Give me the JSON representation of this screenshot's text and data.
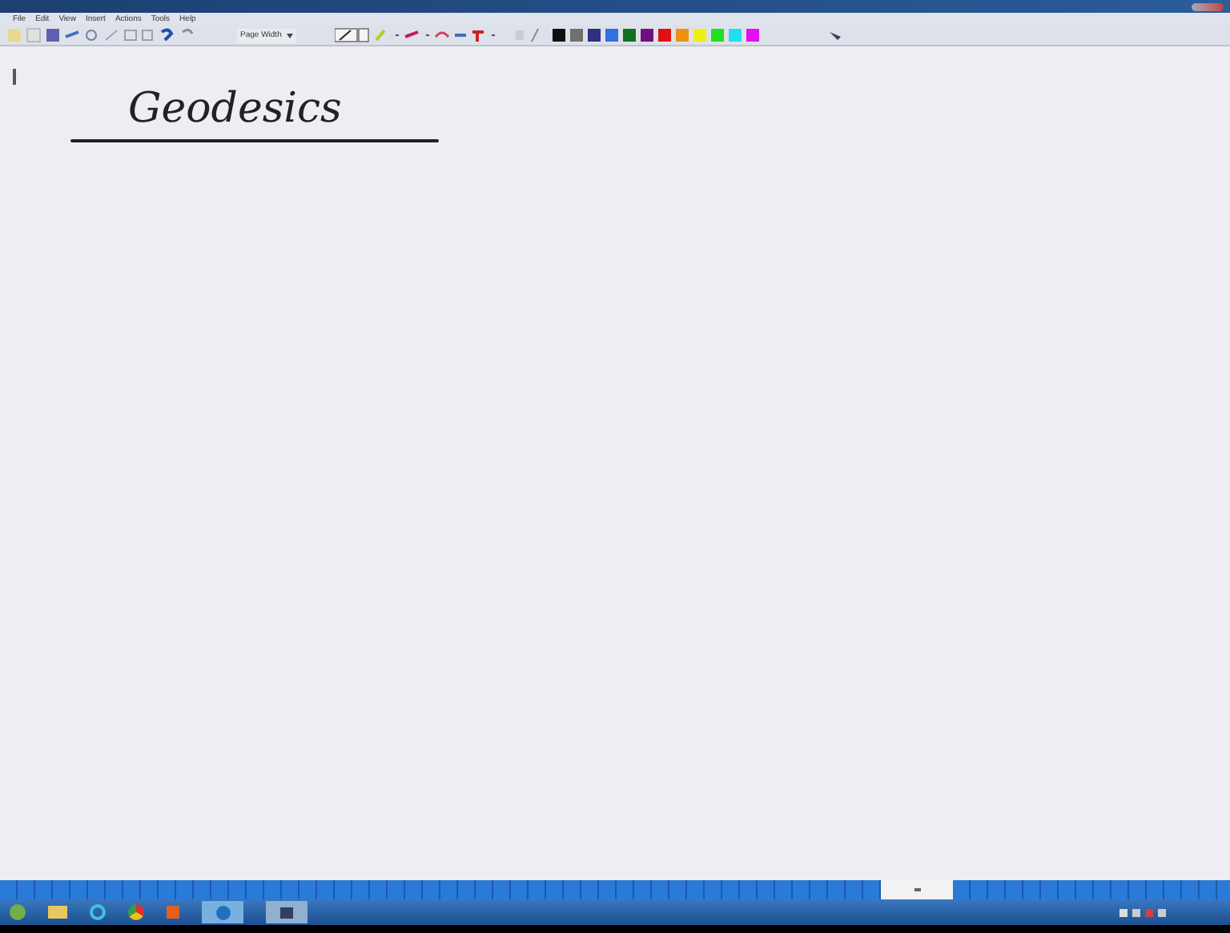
{
  "menu": [
    "File",
    "Edit",
    "View",
    "Insert",
    "Actions",
    "Tools",
    "Help"
  ],
  "toolbar": {
    "zoom_select": "Page Width"
  },
  "pen_colors": [
    {
      "color": "#101010"
    },
    {
      "color": "#707070"
    },
    {
      "color": "#303080"
    },
    {
      "color": "#3070e0"
    },
    {
      "color": "#107020"
    },
    {
      "color": "#701080"
    },
    {
      "color": "#e01010"
    },
    {
      "color": "#f09010"
    },
    {
      "color": "#f0f010"
    },
    {
      "color": "#20e020"
    },
    {
      "color": "#20e0f0"
    },
    {
      "color": "#e010f0"
    }
  ],
  "page": {
    "heading": "Geodesics"
  }
}
